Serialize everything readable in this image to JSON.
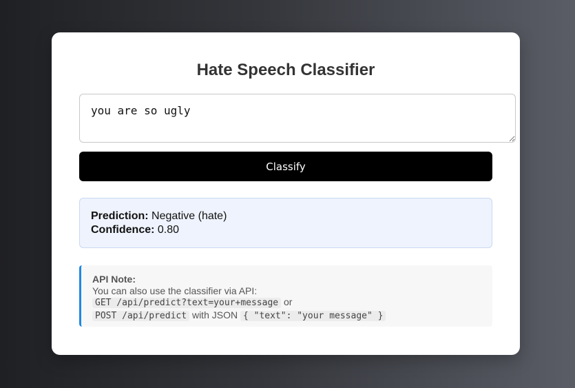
{
  "card": {
    "title": "Hate Speech Classifier",
    "input_value": "you are so ugly",
    "classify_label": "Classify"
  },
  "result": {
    "prediction_label": "Prediction:",
    "prediction_value": "Negative (hate)",
    "confidence_label": "Confidence:",
    "confidence_value": "0.80"
  },
  "api_note": {
    "heading": "API Note:",
    "line1": "You can also use the classifier via API:",
    "get_code": "GET /api/predict?text=your+message",
    "or_text": "or",
    "post_code": "POST /api/predict",
    "with_json_text": "with JSON",
    "json_code": "{ \"text\": \"your message\" }"
  },
  "colors": {
    "button_bg": "#000000",
    "result_bg": "#eef3fd",
    "note_accent": "#1e88e5"
  }
}
